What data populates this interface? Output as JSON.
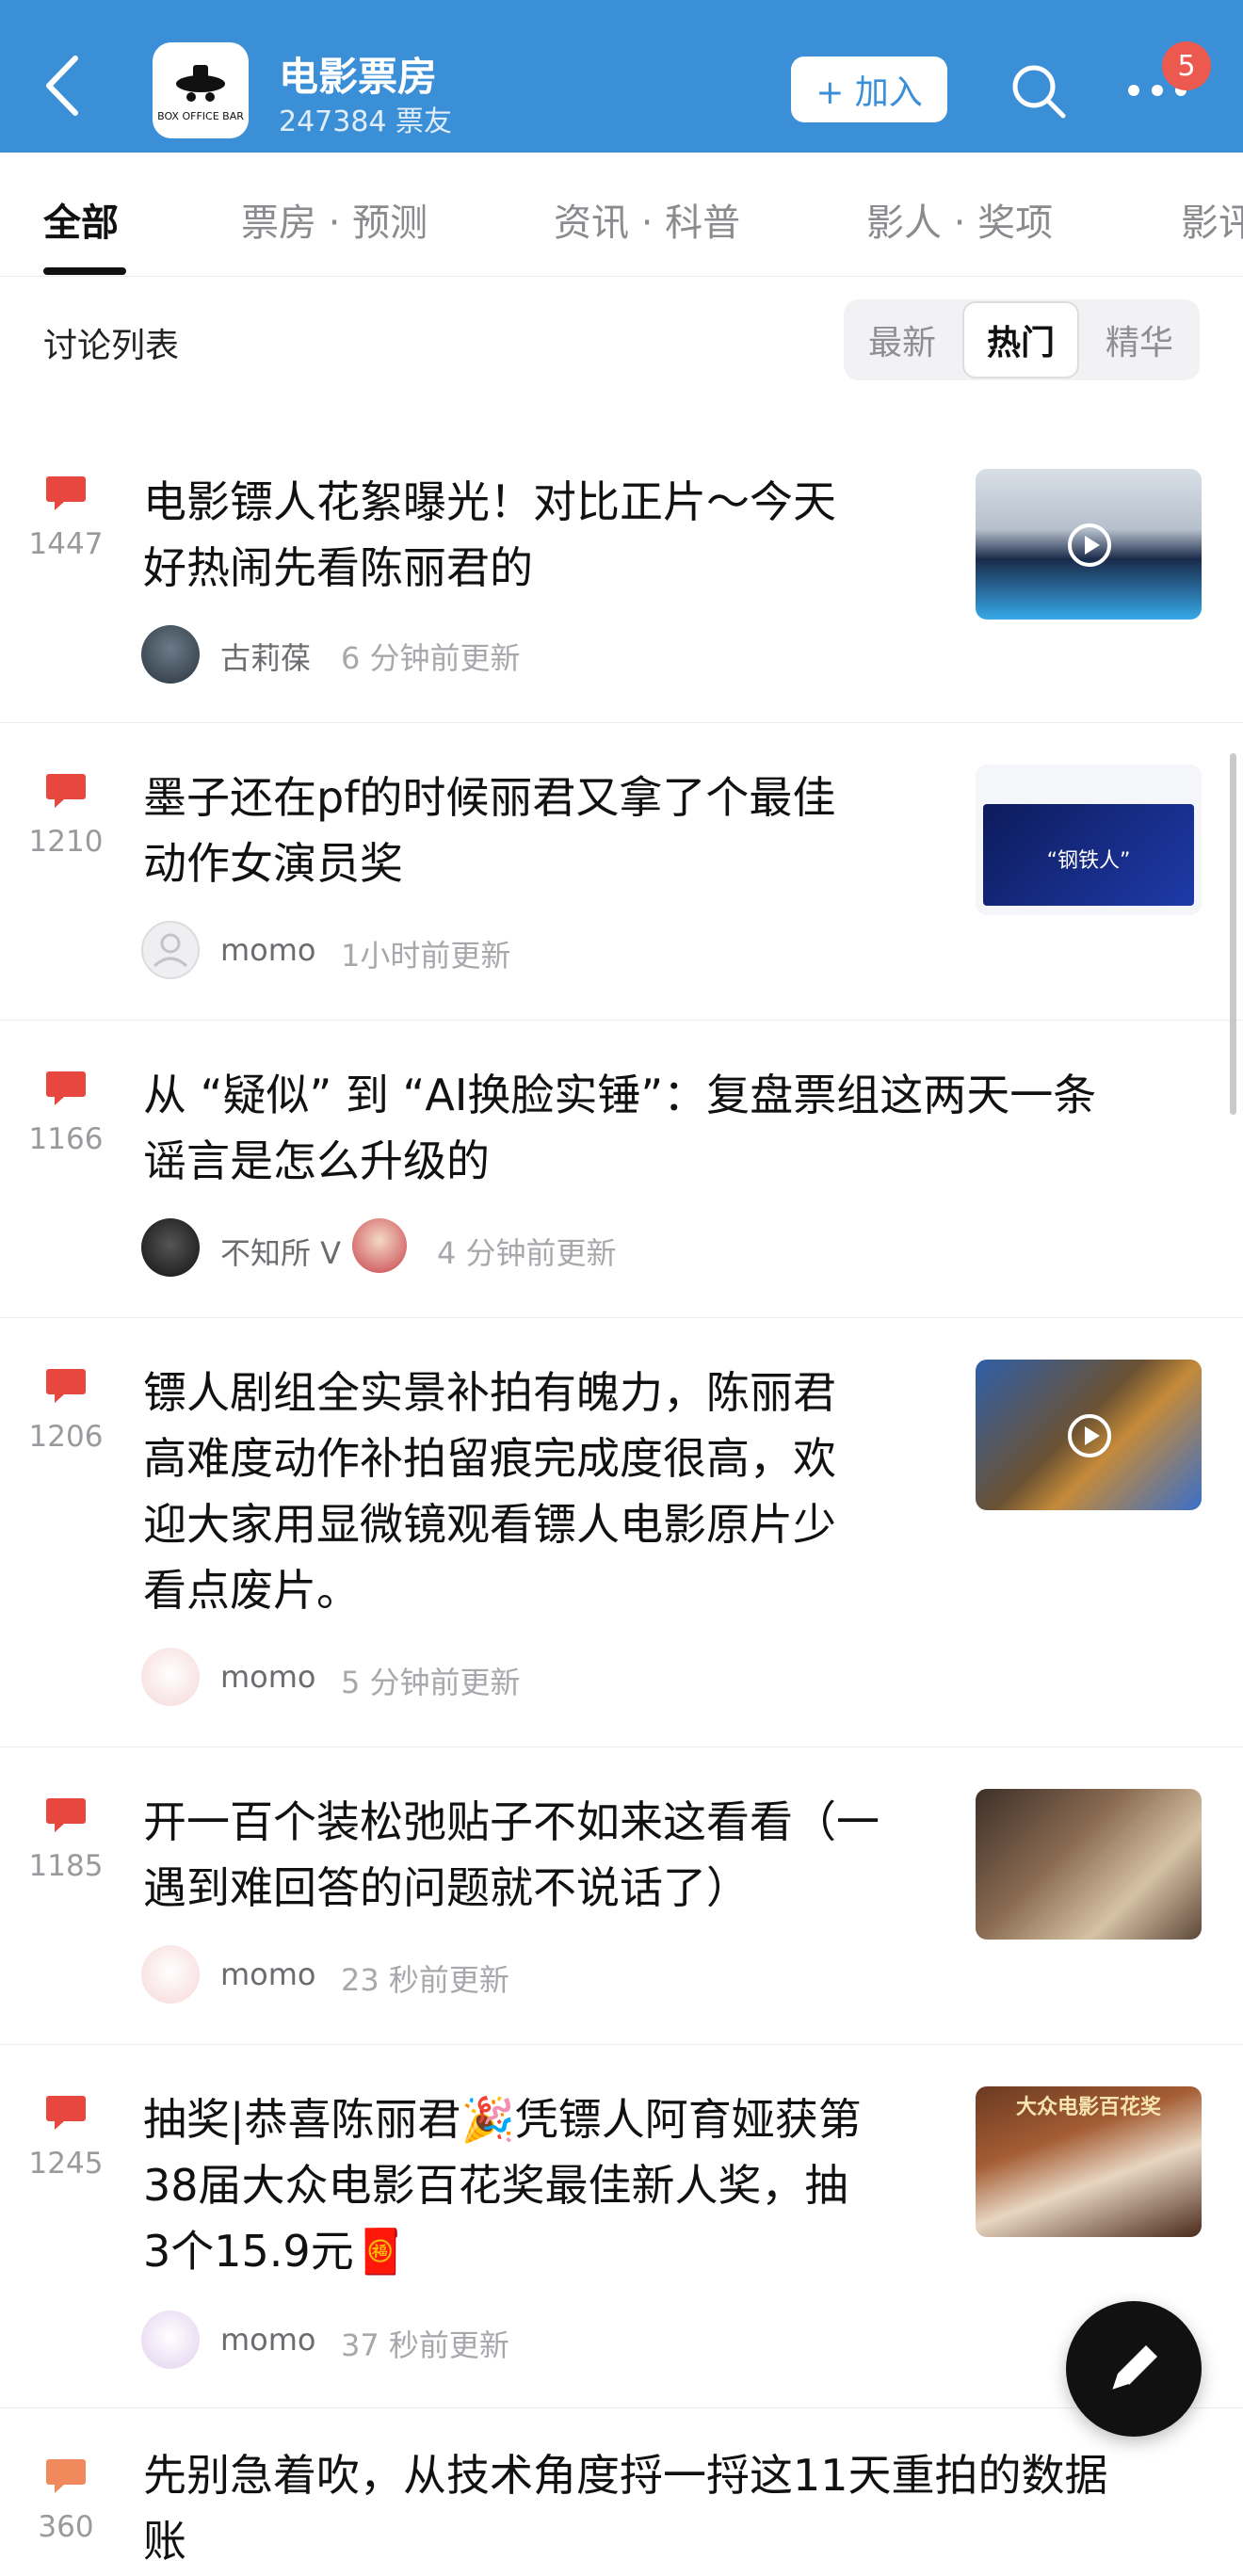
{
  "header": {
    "forum_name": "电影票房",
    "member_count": "247384 票友",
    "join_label": "+ 加入",
    "notification_count": "5",
    "logo_text": "BOX OFFICE BAR",
    "bg_color": "#3a8fd6"
  },
  "tabs": [
    {
      "label": "全部",
      "active": true
    },
    {
      "label": "票房 · 预测"
    },
    {
      "label": "资讯 · 科普"
    },
    {
      "label": "影人 · 奖项"
    },
    {
      "label": "影评"
    }
  ],
  "list": {
    "title": "讨论列表",
    "sort": [
      {
        "label": "最新"
      },
      {
        "label": "热门",
        "active": true
      },
      {
        "label": "精华"
      }
    ]
  },
  "posts": [
    {
      "comments": "1447",
      "title_lines": [
        "电影镖人花絮曝光！对比正片～今天",
        "好热闹先看陈丽君的"
      ],
      "author": "古莉葆",
      "time": "6 分钟前更新",
      "thumb": "video"
    },
    {
      "comments": "1210",
      "title_lines": [
        "墨子还在pf的时候丽君又拿了个最佳",
        "动作女演员奖"
      ],
      "author": "momo",
      "time": "1小时前更新",
      "thumb": "image",
      "thumb_text": "“钢铁人”"
    },
    {
      "comments": "1166",
      "title_lines": [
        "从 “疑似” 到 “AI换脸实锤”：复盘票组这两天一条",
        "谣言是怎么升级的"
      ],
      "author": "不知所 V",
      "time": "4 分钟前更新"
    },
    {
      "comments": "1206",
      "title_lines": [
        "镖人剧组全实景补拍有魄力，陈丽君",
        "高难度动作补拍留痕完成度很高，欢",
        "迎大家用显微镜观看镖人电影原片少",
        "看点废片。"
      ],
      "author": "momo",
      "time": "5 分钟前更新",
      "thumb": "video"
    },
    {
      "comments": "1185",
      "title_lines": [
        "开一百个装松弛贴子不如来这看看（一",
        "遇到难回答的问题就不说话了）"
      ],
      "author": "momo",
      "time": "23 秒前更新",
      "thumb": "image"
    },
    {
      "comments": "1245",
      "title_lines": [
        "抽奖|恭喜陈丽君🎉凭镖人阿育娅获第",
        "38届大众电影百花奖最佳新人奖，抽",
        "3个15.9元🧧"
      ],
      "author": "momo",
      "time": "37 秒前更新",
      "thumb": "image",
      "thumb_text": "大众电影百花奖"
    },
    {
      "comments": "360",
      "title_lines": [
        "先别急着吹，从技术角度捋一捋这11天重拍的数据",
        "账"
      ]
    }
  ]
}
